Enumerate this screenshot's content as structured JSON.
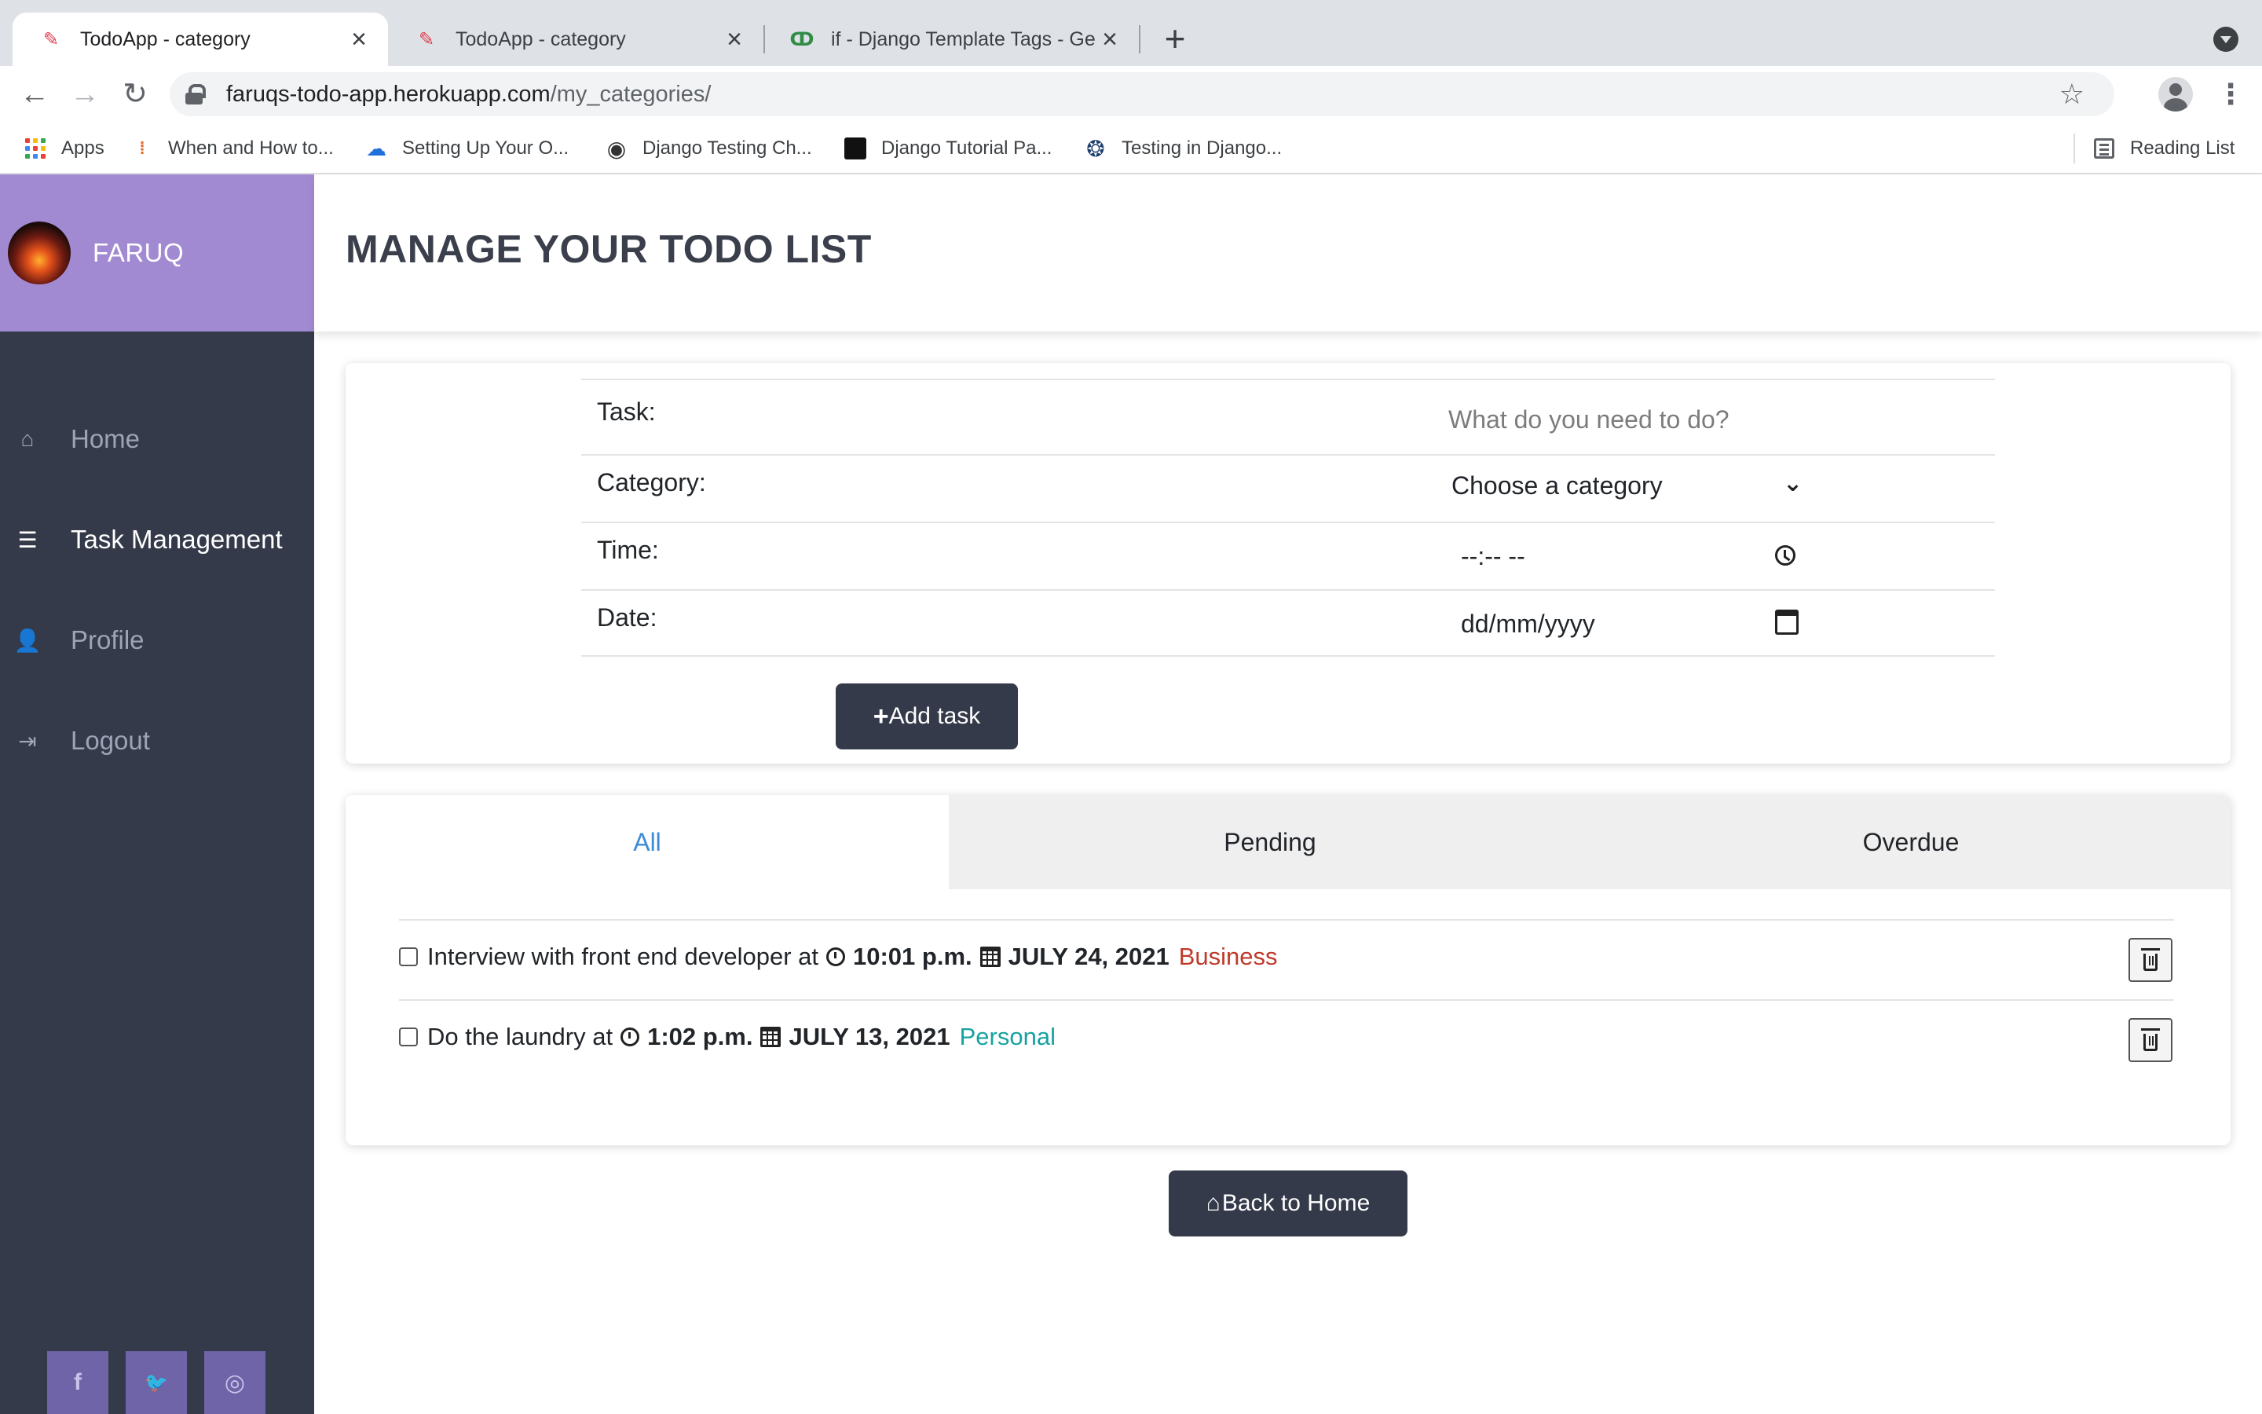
{
  "browser": {
    "tabs": [
      {
        "title": "TodoApp - category",
        "active": true,
        "favicon": "todoapp-favicon"
      },
      {
        "title": "TodoApp - category",
        "active": false,
        "favicon": "todoapp-favicon"
      },
      {
        "title": "if - Django Template Tags - Ge",
        "active": false,
        "favicon": "geeksforgeeks-favicon"
      }
    ],
    "url_host": "faruqs-todo-app.herokuapp.com",
    "url_path": "/my_categories/",
    "bookmarks": [
      {
        "label": "Apps",
        "icon": "apps-grid-icon"
      },
      {
        "label": "When and How to...",
        "icon": "bookmark-site-icon"
      },
      {
        "label": "Setting Up Your O...",
        "icon": "cloud-icon"
      },
      {
        "label": "Django Testing Ch...",
        "icon": "globe-icon"
      },
      {
        "label": "Django Tutorial Pa...",
        "icon": "site-icon"
      },
      {
        "label": "Testing in Django...",
        "icon": "python-icon"
      }
    ],
    "reading_list": "Reading List"
  },
  "sidebar": {
    "user_name": "FARUQ",
    "items": [
      {
        "label": "Home",
        "icon": "home-icon",
        "active": false
      },
      {
        "label": "Task Management",
        "icon": "list-icon",
        "active": true
      },
      {
        "label": "Profile",
        "icon": "user-icon",
        "active": false
      },
      {
        "label": "Logout",
        "icon": "logout-icon",
        "active": false
      }
    ],
    "social": [
      {
        "glyph": "f",
        "icon": "facebook-icon"
      },
      {
        "glyph": "🐦",
        "icon": "twitter-icon"
      },
      {
        "glyph": "◎",
        "icon": "instagram-icon"
      }
    ]
  },
  "header": {
    "title": "MANAGE YOUR TODO LIST"
  },
  "form": {
    "task_label": "Task:",
    "task_placeholder": "What do you need to do?",
    "category_label": "Category:",
    "category_value": "Choose a category",
    "time_label": "Time:",
    "time_value": "--:-- --",
    "date_label": "Date:",
    "date_value": "dd/mm/yyyy",
    "add_button": "Add task"
  },
  "filters": {
    "all": "All",
    "pending": "Pending",
    "overdue": "Overdue",
    "active": "All"
  },
  "tasks": [
    {
      "text": "Interview with front end developer at",
      "time": "10:01 p.m.",
      "date": "JULY 24, 2021",
      "category": "Business"
    },
    {
      "text": "Do the laundry at",
      "time": "1:02 p.m.",
      "date": "JULY 13, 2021",
      "category": "Personal"
    }
  ],
  "back_button": "Back to Home",
  "colors": {
    "sidebar_bg": "#343a4a",
    "sidebar_header": "#a28ad2",
    "accent_blue": "#3b8bd6",
    "business": "#c0392b",
    "personal": "#17a2a2"
  }
}
